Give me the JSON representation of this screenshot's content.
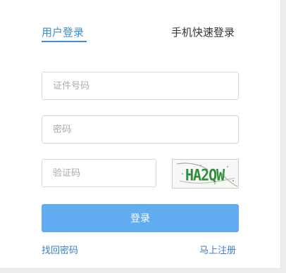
{
  "tabs": {
    "user_login": "用户登录",
    "phone_login": "手机快速登录"
  },
  "form": {
    "id_placeholder": "证件号码",
    "password_placeholder": "密码",
    "code_placeholder": "验证码",
    "captcha_text": "HA2QW",
    "login_label": "登录"
  },
  "links": {
    "forgot_password": "找回密码",
    "register": "马上注册"
  },
  "colors": {
    "accent": "#3a8fd6",
    "button": "#61abf0",
    "captcha_text": "#2f8f3a"
  }
}
